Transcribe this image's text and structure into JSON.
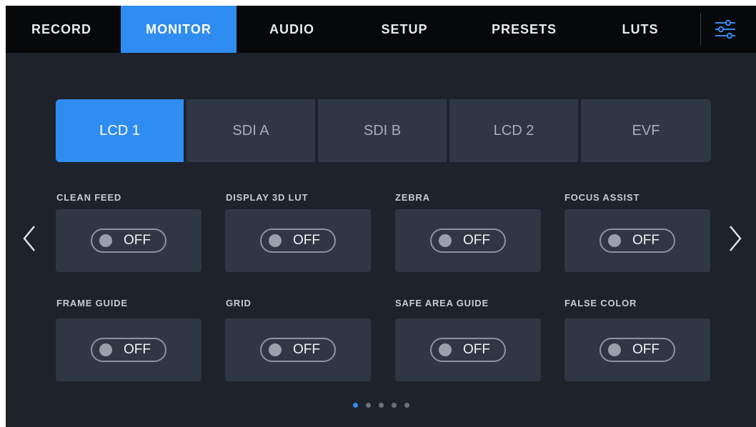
{
  "tabs": [
    {
      "label": "RECORD"
    },
    {
      "label": "MONITOR",
      "active": true
    },
    {
      "label": "AUDIO"
    },
    {
      "label": "SETUP"
    },
    {
      "label": "PRESETS"
    },
    {
      "label": "LUTS"
    }
  ],
  "settings_icon": "sliders-icon",
  "outputs": [
    {
      "label": "LCD 1",
      "active": true
    },
    {
      "label": "SDI A"
    },
    {
      "label": "SDI B"
    },
    {
      "label": "LCD 2"
    },
    {
      "label": "EVF"
    }
  ],
  "options": [
    {
      "label": "CLEAN FEED",
      "state": "OFF"
    },
    {
      "label": "DISPLAY 3D LUT",
      "state": "OFF"
    },
    {
      "label": "ZEBRA",
      "state": "OFF"
    },
    {
      "label": "FOCUS ASSIST",
      "state": "OFF"
    },
    {
      "label": "FRAME GUIDE",
      "state": "OFF"
    },
    {
      "label": "GRID",
      "state": "OFF"
    },
    {
      "label": "SAFE AREA GUIDE",
      "state": "OFF"
    },
    {
      "label": "FALSE COLOR",
      "state": "OFF"
    }
  ],
  "pagination": {
    "pages": 5,
    "current": 1
  },
  "colors": {
    "accent": "#2f8cf0",
    "background": "#1e222a",
    "tabbar": "#07080a",
    "card": "#303744"
  }
}
